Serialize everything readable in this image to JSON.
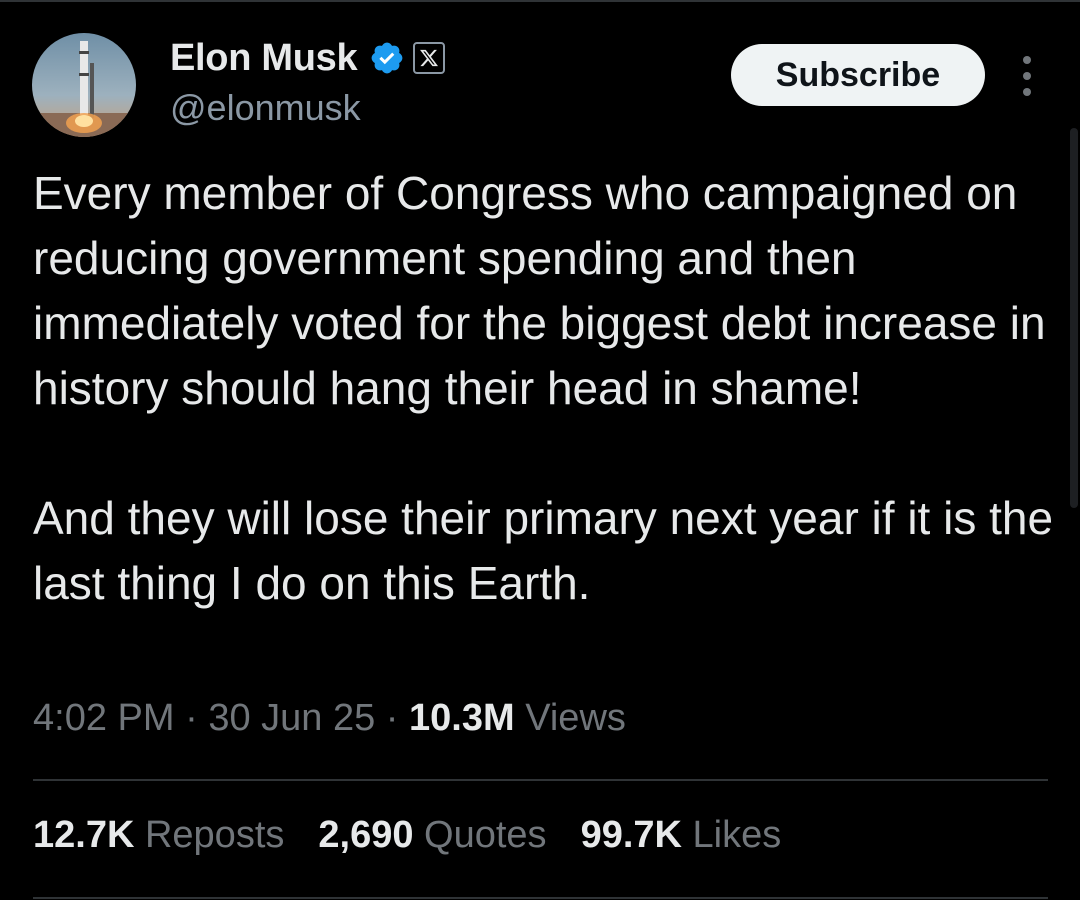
{
  "author": {
    "display_name": "Elon Musk",
    "handle": "@elonmusk",
    "verified_icon": "verified-badge-icon",
    "affiliation_icon": "x-logo-icon"
  },
  "header": {
    "subscribe_label": "Subscribe",
    "more_icon": "more-vertical-icon"
  },
  "tweet": {
    "paragraph_1": "Every member of Congress who campaigned on reducing government spending and then immediately voted for the biggest debt increase in history should hang their head in shame!",
    "paragraph_2": "And they will lose their primary next year if it is the last thing I do on this Earth."
  },
  "meta": {
    "time": "4:02 PM",
    "separator": "·",
    "date": "30 Jun 25",
    "views_count": "10.3M",
    "views_label": "Views"
  },
  "stats": {
    "reposts_count": "12.7K",
    "reposts_label": "Reposts",
    "quotes_count": "2,690",
    "quotes_label": "Quotes",
    "likes_count": "99.7K",
    "likes_label": "Likes"
  },
  "colors": {
    "background": "#000000",
    "primary_text": "#e7e9ea",
    "secondary_text": "#71767b",
    "verified_blue": "#1d9bf0",
    "divider": "#2f3336"
  }
}
